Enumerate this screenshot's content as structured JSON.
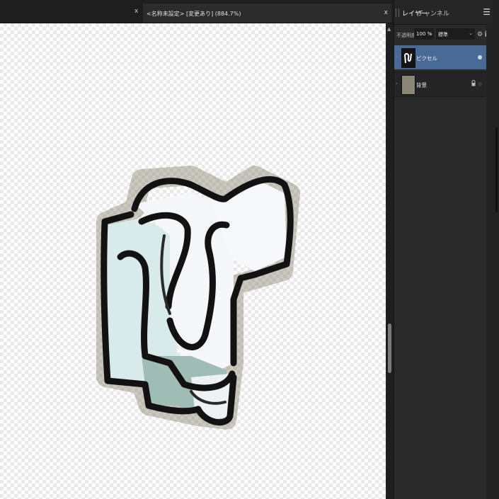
{
  "document": {
    "tab_title": "<名称未設定> [変更あり] (884.7%)",
    "close_glyph": "x"
  },
  "layers_panel": {
    "tabs": [
      "レイヤー",
      "チャンネル"
    ],
    "menu_icon": "hamburger-icon",
    "opacity_label": "不透明度:",
    "opacity_value": "100 %",
    "blend_mode": "標準",
    "layers": [
      {
        "name": "ピクセル",
        "selected": true,
        "visible": true,
        "locked": false
      },
      {
        "name": "背景",
        "selected": false,
        "visible": false,
        "locked": true
      }
    ]
  },
  "colors": {
    "selection": "#4a6a96",
    "panel": "#2a2a2a",
    "canvas_checker": "#e9e9e9"
  }
}
